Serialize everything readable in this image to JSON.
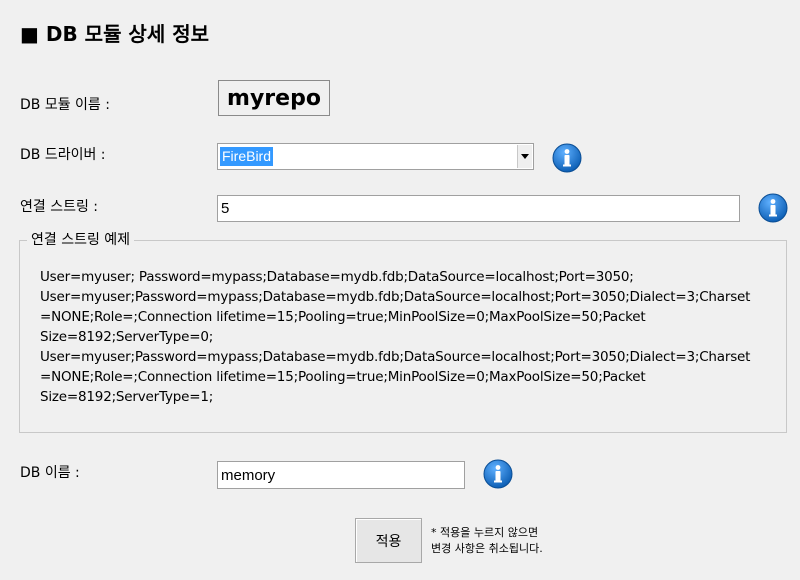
{
  "heading": "■ DB 모듈 상세 정보",
  "module_name": {
    "label": "DB 모듈 이름 :",
    "value": "myrepo"
  },
  "driver": {
    "label": "DB 드라이버 :",
    "selected": "FireBird",
    "info_icon": "info-icon"
  },
  "connection_string": {
    "label": "연결 스트링 :",
    "value": "5",
    "info_icon": "info-icon"
  },
  "examples": {
    "legend": "연결 스트링 예제",
    "lines": [
      "User=myuser; Password=mypass;Database=mydb.fdb;DataSource=localhost;Port=3050;",
      "User=myuser;Password=mypass;Database=mydb.fdb;DataSource=localhost;Port=3050;Dialect=3;Charset",
      "=NONE;Role=;Connection lifetime=15;Pooling=true;MinPoolSize=0;MaxPoolSize=50;Packet",
      "Size=8192;ServerType=0;",
      "User=myuser;Password=mypass;Database=mydb.fdb;DataSource=localhost;Port=3050;Dialect=3;Charset",
      "=NONE;Role=;Connection lifetime=15;Pooling=true;MinPoolSize=0;MaxPoolSize=50;Packet",
      "Size=8192;ServerType=1;"
    ]
  },
  "db_name": {
    "label": "DB 이름 :",
    "value": "memory",
    "info_icon": "info-icon"
  },
  "apply": {
    "button_label": "적용",
    "note_line1": "* 적용을 누르지 않으면",
    "note_line2": "변경 사항은 취소됩니다."
  },
  "colors": {
    "background": "#f0f0f0",
    "selection": "#3399ff",
    "info_blue": "#1a6fc4"
  }
}
